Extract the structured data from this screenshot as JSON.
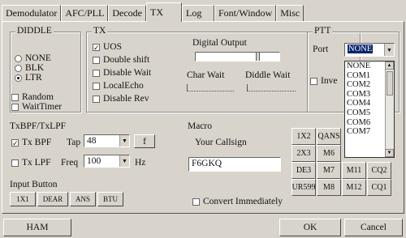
{
  "tabs": [
    "Demodulator",
    "AFC/PLL",
    "Decode",
    "TX",
    "Log",
    "Font/Window",
    "Misc"
  ],
  "active_tab": "TX",
  "diddle": {
    "title": "DIDDLE",
    "options": [
      "NONE",
      "BLK",
      "LTR"
    ],
    "selected": "LTR",
    "random": "Random",
    "waittimer": "WaitTimer"
  },
  "tx": {
    "title": "TX",
    "options": [
      "UOS",
      "Double shift",
      "Disable Wait",
      "LocalEcho",
      "Disable Rev"
    ],
    "checked": [
      "UOS"
    ]
  },
  "digital": {
    "label": "Digital Output",
    "char_wait": "Char Wait",
    "diddle_wait": "Diddle Wait"
  },
  "ptt": {
    "title": "PTT",
    "port_label": "Port",
    "port_value": "NONE",
    "invert_label": "Inve",
    "port_options": [
      "NONE",
      "COM1",
      "COM2",
      "COM3",
      "COM4",
      "COM5",
      "COM6",
      "COM7"
    ]
  },
  "filter": {
    "title": "TxBPF/TxLPF",
    "bpf_label": "Tx BPF",
    "tap_label": "Tap",
    "tap_value": "48",
    "f_button": "f",
    "lpf_label": "Tx LPF",
    "freq_label": "Freq",
    "freq_value": "100",
    "hz": "Hz"
  },
  "input_button": {
    "title": "Input Button",
    "buttons": [
      "1X1",
      "DEAR",
      "ANS",
      "BTU"
    ]
  },
  "macro": {
    "title": "Macro",
    "callsign_label": "Your Callsign",
    "callsign_value": "F6GKQ",
    "convert_label": "Convert Immediately",
    "cells": [
      [
        "1X2",
        "QANS",
        "",
        ""
      ],
      [
        "2X3",
        "M6",
        "",
        ""
      ],
      [
        "DE3",
        "M7",
        "M11",
        "CQ2"
      ],
      [
        "UR599",
        "M8",
        "M12",
        "CQ1"
      ]
    ]
  },
  "footer": {
    "ham": "HAM",
    "ok": "OK",
    "cancel": "Cancel"
  }
}
